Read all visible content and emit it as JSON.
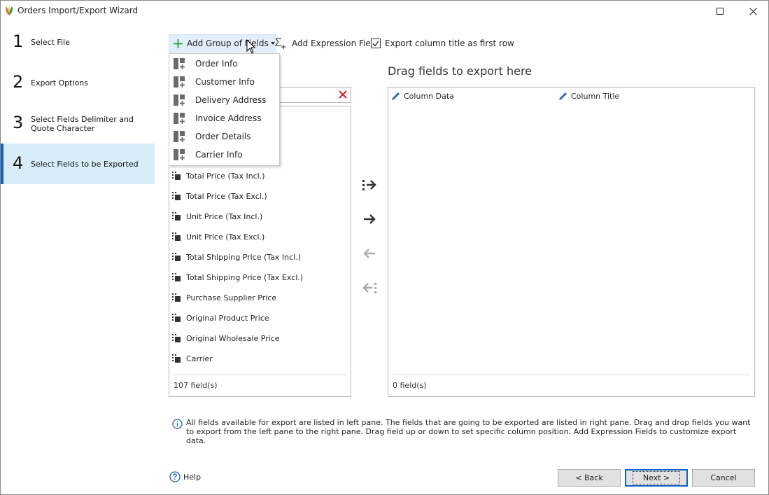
{
  "window": {
    "title": "Orders Import/Export Wizard"
  },
  "steps": [
    {
      "number": "1",
      "label": "Select File"
    },
    {
      "number": "2",
      "label": "Export Options"
    },
    {
      "number": "3",
      "label": "Select Fields Delimiter and Quote Character"
    },
    {
      "number": "4",
      "label": "Select Fields to be Exported"
    }
  ],
  "toolbar": {
    "add_group_label": "Add Group of Fields",
    "add_expression_label": "Add Expression Field",
    "export_title_label": "Export column title as first row",
    "export_title_checked": true
  },
  "dropdown": {
    "items": [
      "Order Info",
      "Customer Info",
      "Delivery Address",
      "Invoice Address",
      "Order Details",
      "Carrier Info"
    ]
  },
  "left_pane": {
    "search_value": "",
    "fields": [
      "Total Price (Tax Incl.)",
      "Total Price (Tax Excl.)",
      "Unit Price (Tax Incl.)",
      "Unit Price (Tax Excl.)",
      "Total Shipping Price (Tax Incl.)",
      "Total Shipping Price (Tax Excl.)",
      "Purchase Supplier Price",
      "Original Product Price",
      "Original Wholesale Price",
      "Carrier"
    ],
    "count_label": "107 field(s)"
  },
  "right_pane": {
    "title": "Drag fields to export here",
    "col_data": "Column Data",
    "col_title": "Column Title",
    "count_label": "0 field(s)"
  },
  "info_text": "All fields available for export are listed in left pane. The fields that are going to be exported are listed in right pane. Drag and drop fields you want to export from the left pane to the right pane. Drag field up or down to set specific column position. Add Expression Fields to customize export data.",
  "footer": {
    "help_label": "Help",
    "back_label": "< Back",
    "next_label": "Next >",
    "cancel_label": "Cancel"
  },
  "colors": {
    "accent": "#1a64b7",
    "active_step_bg": "#d9ecfa",
    "add_green": "#2e9b3a",
    "clear_red": "#d9202c",
    "pencil_blue": "#2a63b9"
  }
}
